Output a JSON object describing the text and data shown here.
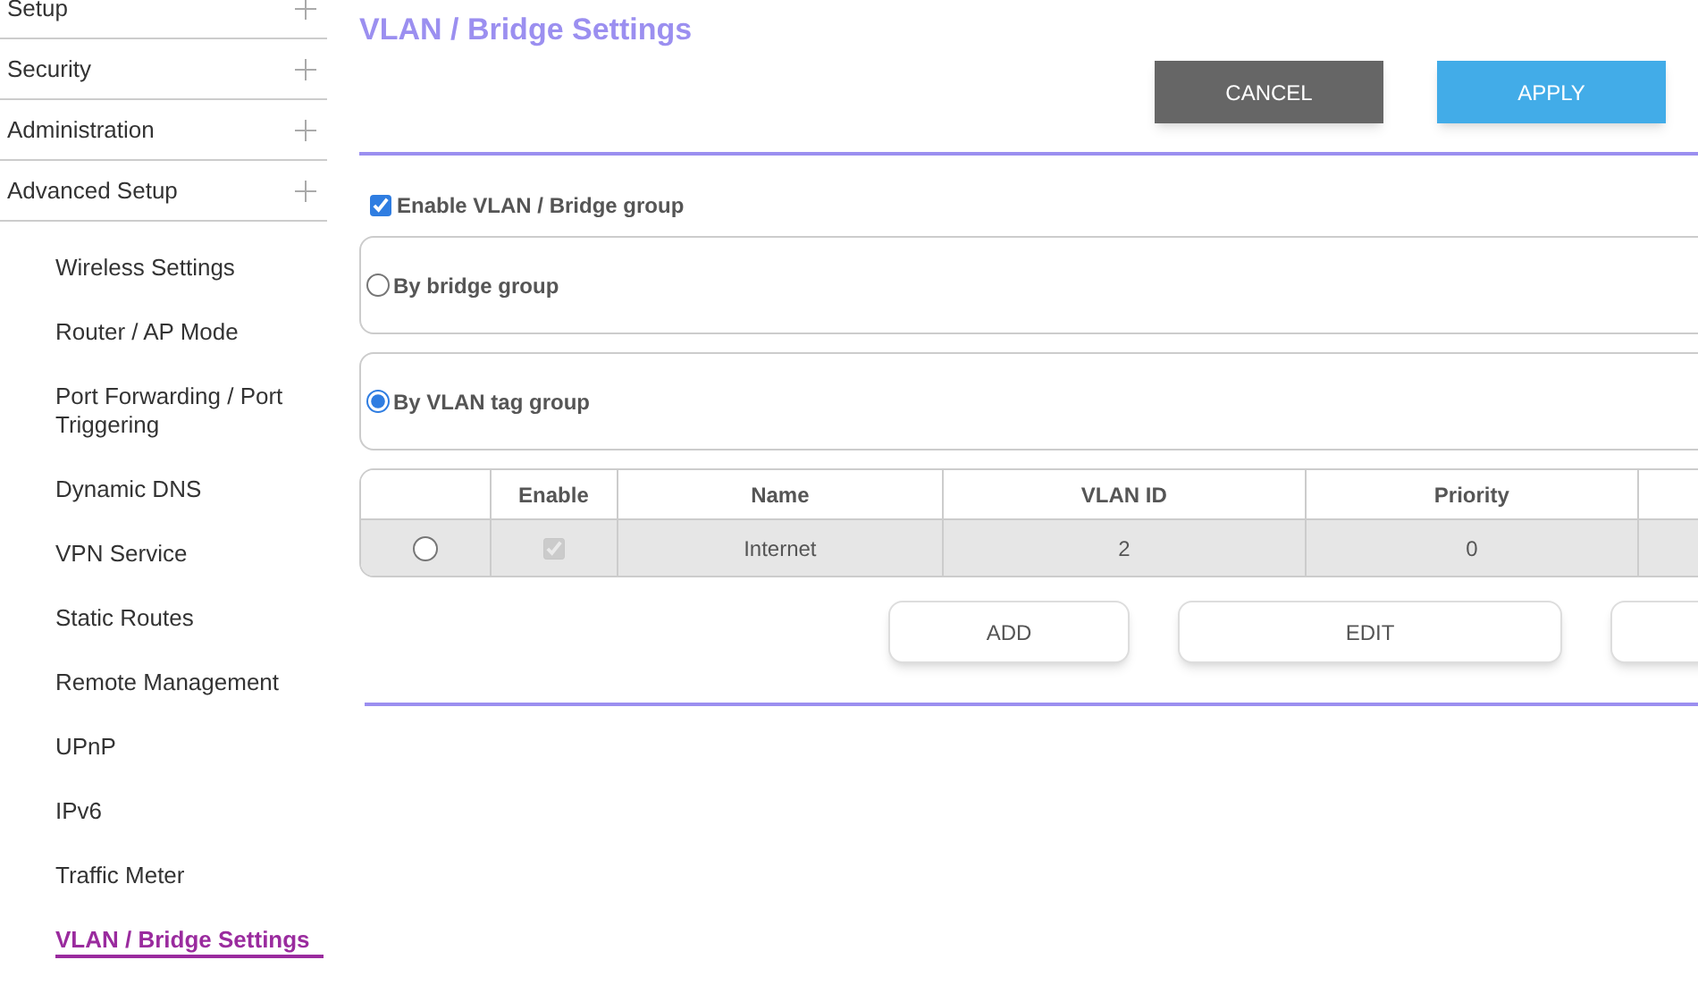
{
  "sidebar": {
    "menus": [
      {
        "label": "Setup",
        "expanded": false
      },
      {
        "label": "Security",
        "expanded": false
      },
      {
        "label": "Administration",
        "expanded": false
      },
      {
        "label": "Advanced Setup",
        "expanded": false
      }
    ],
    "items": [
      {
        "label": "Wireless Settings",
        "selected": false
      },
      {
        "label": "Router / AP Mode",
        "selected": false
      },
      {
        "label": "Port Forwarding / Port Triggering",
        "selected": false
      },
      {
        "label": "Dynamic DNS",
        "selected": false
      },
      {
        "label": "VPN Service",
        "selected": false
      },
      {
        "label": "Static Routes",
        "selected": false
      },
      {
        "label": "Remote Management",
        "selected": false
      },
      {
        "label": "UPnP",
        "selected": false
      },
      {
        "label": "IPv6",
        "selected": false
      },
      {
        "label": "Traffic Meter",
        "selected": false
      },
      {
        "label": "VLAN / Bridge Settings",
        "selected": true
      }
    ]
  },
  "title": "VLAN / Bridge Settings",
  "buttons": [
    "CANCEL",
    "APPLY"
  ],
  "enable": {
    "label": "Enable VLAN / Bridge group",
    "checked": true
  },
  "modes": [
    {
      "label": "By bridge group",
      "selected": false
    },
    {
      "label": "By VLAN tag group",
      "selected": true
    }
  ],
  "table": {
    "columns": [
      "",
      "Enable",
      "Name",
      "VLAN ID",
      "Priority"
    ],
    "rows": [
      {
        "selected": false,
        "enabled": true,
        "name": "Internet",
        "vlan_id": "2",
        "priority": "0"
      }
    ]
  },
  "table_buttons": [
    {
      "kind": "labeled",
      "label": "ADD"
    },
    {
      "kind": "labeled",
      "label": "EDIT"
    },
    {
      "kind": "blank"
    }
  ]
}
